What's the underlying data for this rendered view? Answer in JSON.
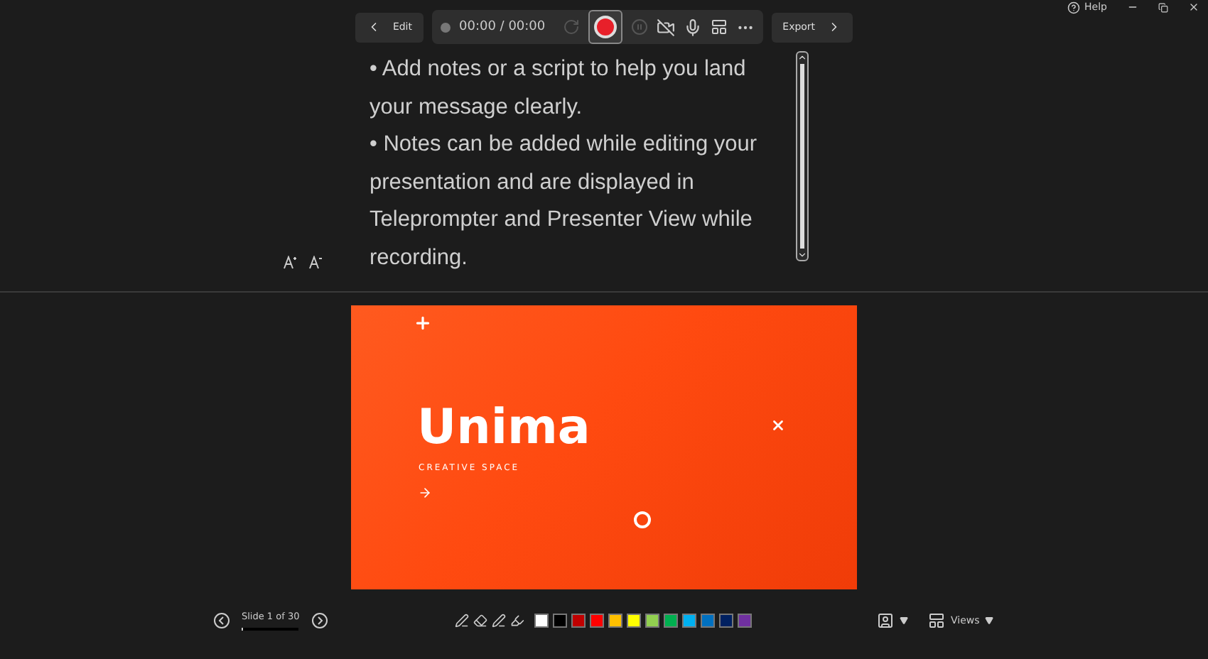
{
  "window": {
    "help": "Help"
  },
  "toolbar": {
    "edit_button": "Edit",
    "timer": "00:00 / 00:00",
    "export_button": "Export"
  },
  "notes": {
    "paragraphs": [
      "• Add notes or a script to help you land your message clearly.",
      "• Notes can be added while editing your presentation and are displayed in Teleprompter and Presenter View while recording."
    ]
  },
  "slide": {
    "title": "Unima",
    "subtitle": "CREATIVE SPACE"
  },
  "navigation": {
    "label": "Slide 1 of 30",
    "level": 0.033
  },
  "swatches": [
    {
      "color": "#ffffff"
    },
    {
      "color": "#000000"
    },
    {
      "color": "#c00000"
    },
    {
      "color": "#ff0000"
    },
    {
      "color": "#ffc000"
    },
    {
      "color": "#ffff00"
    },
    {
      "color": "#92d050"
    },
    {
      "color": "#00b050"
    },
    {
      "color": "#00b0f0"
    },
    {
      "color": "#0070c0"
    },
    {
      "color": "#002060"
    },
    {
      "color": "#7030a0"
    }
  ],
  "views_button": "Views"
}
